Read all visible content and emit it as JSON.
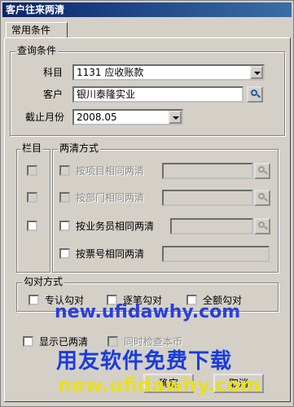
{
  "window": {
    "title": "客户往来两清"
  },
  "tabs": [
    {
      "label": "常用条件"
    }
  ],
  "query": {
    "group_title": "查询条件",
    "subject_label": "科目",
    "subject_value": "1131 应收账款",
    "customer_label": "客户",
    "customer_value": "银川泰隆实业",
    "month_label": "截止月份",
    "month_value": "2008.05"
  },
  "columns": {
    "group_title": "栏目"
  },
  "clearing": {
    "group_title": "两清方式",
    "options": [
      {
        "label": "按项目相同两清"
      },
      {
        "label": "按部门相同两清"
      },
      {
        "label": "按业务员相同两清"
      },
      {
        "label": "按票号相同两清"
      }
    ]
  },
  "matching": {
    "group_title": "勾对方式",
    "options": [
      {
        "label": "专认勾对"
      },
      {
        "label": "逐笔勾对"
      },
      {
        "label": "全额勾对"
      }
    ]
  },
  "bottom": {
    "show_cleared_label": "显示已两清",
    "check_at_same_time_label": "同时检查本币"
  },
  "buttons": {
    "ok": "确定",
    "cancel": "取消"
  },
  "watermarks": {
    "url_1": "new.ufidawhy.com",
    "slogan": "用友软件免费下载",
    "url_2": "new.ufidawhy.com"
  }
}
